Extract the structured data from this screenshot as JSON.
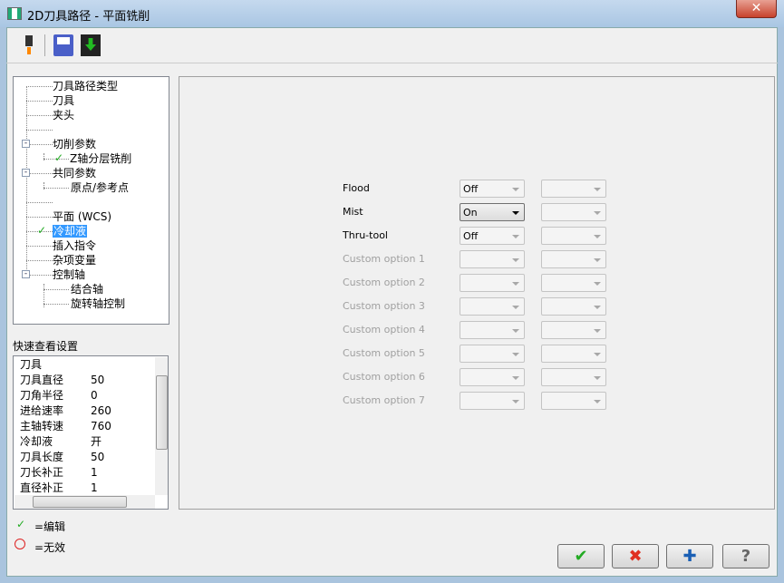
{
  "window": {
    "title": "2D刀具路径 - 平面铣削",
    "close_label": "✕"
  },
  "toolbar": {
    "icons": [
      "tool-icon",
      "save-icon",
      "save-load-icon"
    ]
  },
  "tree": {
    "items": [
      {
        "label": "刀具路径类型"
      },
      {
        "label": "刀具"
      },
      {
        "label": "夹头"
      },
      {
        "label": ""
      },
      {
        "label": "切削参数"
      },
      {
        "label": "Z轴分层铣削"
      },
      {
        "label": "共同参数"
      },
      {
        "label": "原点/参考点"
      },
      {
        "label": ""
      },
      {
        "label": "平面 (WCS)"
      },
      {
        "label": "冷却液"
      },
      {
        "label": "插入指令"
      },
      {
        "label": "杂项变量"
      },
      {
        "label": "控制轴"
      },
      {
        "label": "结合轴"
      },
      {
        "label": "旋转轴控制"
      }
    ]
  },
  "coolant": {
    "rows": [
      {
        "label": "Flood",
        "value": "Off"
      },
      {
        "label": "Mist",
        "value": "On"
      },
      {
        "label": "Thru-tool",
        "value": "Off"
      },
      {
        "label": "Custom option 1",
        "value": ""
      },
      {
        "label": "Custom option 2",
        "value": ""
      },
      {
        "label": "Custom option 3",
        "value": ""
      },
      {
        "label": "Custom option 4",
        "value": ""
      },
      {
        "label": "Custom option 5",
        "value": ""
      },
      {
        "label": "Custom option 6",
        "value": ""
      },
      {
        "label": "Custom option 7",
        "value": ""
      }
    ]
  },
  "quick_view": {
    "title": "快速查看设置",
    "header": "刀具",
    "rows": [
      {
        "k": "刀具直径",
        "v": "50"
      },
      {
        "k": "刀角半径",
        "v": "0"
      },
      {
        "k": "进给速率",
        "v": "260"
      },
      {
        "k": "主轴转速",
        "v": "760"
      },
      {
        "k": "冷却液",
        "v": "开"
      },
      {
        "k": "刀具长度",
        "v": "50"
      },
      {
        "k": "刀长补正",
        "v": "1"
      },
      {
        "k": "直径补正",
        "v": "1"
      }
    ]
  },
  "legend": {
    "edited": "=编辑",
    "disabled": "=无效"
  },
  "buttons": {
    "ok": "✔",
    "cancel": "✖",
    "add": "✚",
    "help": "?"
  },
  "colors": {
    "selection": "#3399ff",
    "check": "#22aa22",
    "cancel": "#e03020",
    "add": "#1a5fb4"
  }
}
